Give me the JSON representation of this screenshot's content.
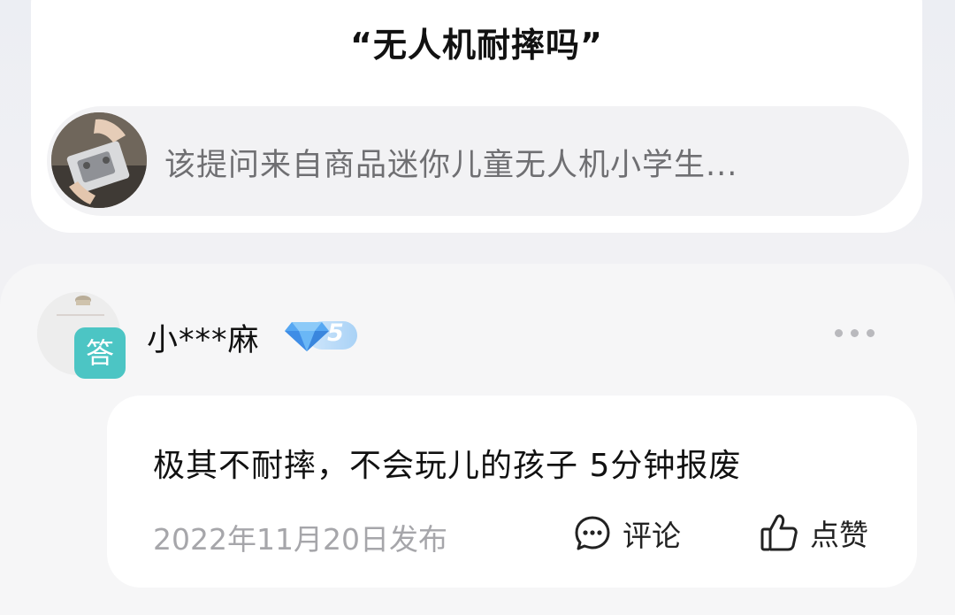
{
  "question": {
    "title": "“无人机耐摔吗”",
    "source_text": "该提问来自商品迷你儿童无人机小学生..."
  },
  "answer": {
    "badge_label": "答",
    "username": "小***麻",
    "level": "5",
    "text": "极其不耐摔，不会玩儿的孩子 5分钟报废",
    "date": "2022年11月20日发布",
    "comment_label": "评论",
    "like_label": "点赞"
  },
  "icons": {
    "product": "product-thumbnail",
    "level": "diamond-icon",
    "more": "more-icon",
    "comment": "comment-icon",
    "like": "thumbs-up-icon"
  },
  "colors": {
    "answer_badge": "#4cc5c4",
    "level_badge": "#a9d2f6",
    "muted_text": "#a6a6aa",
    "source_text": "#6f6f72"
  }
}
